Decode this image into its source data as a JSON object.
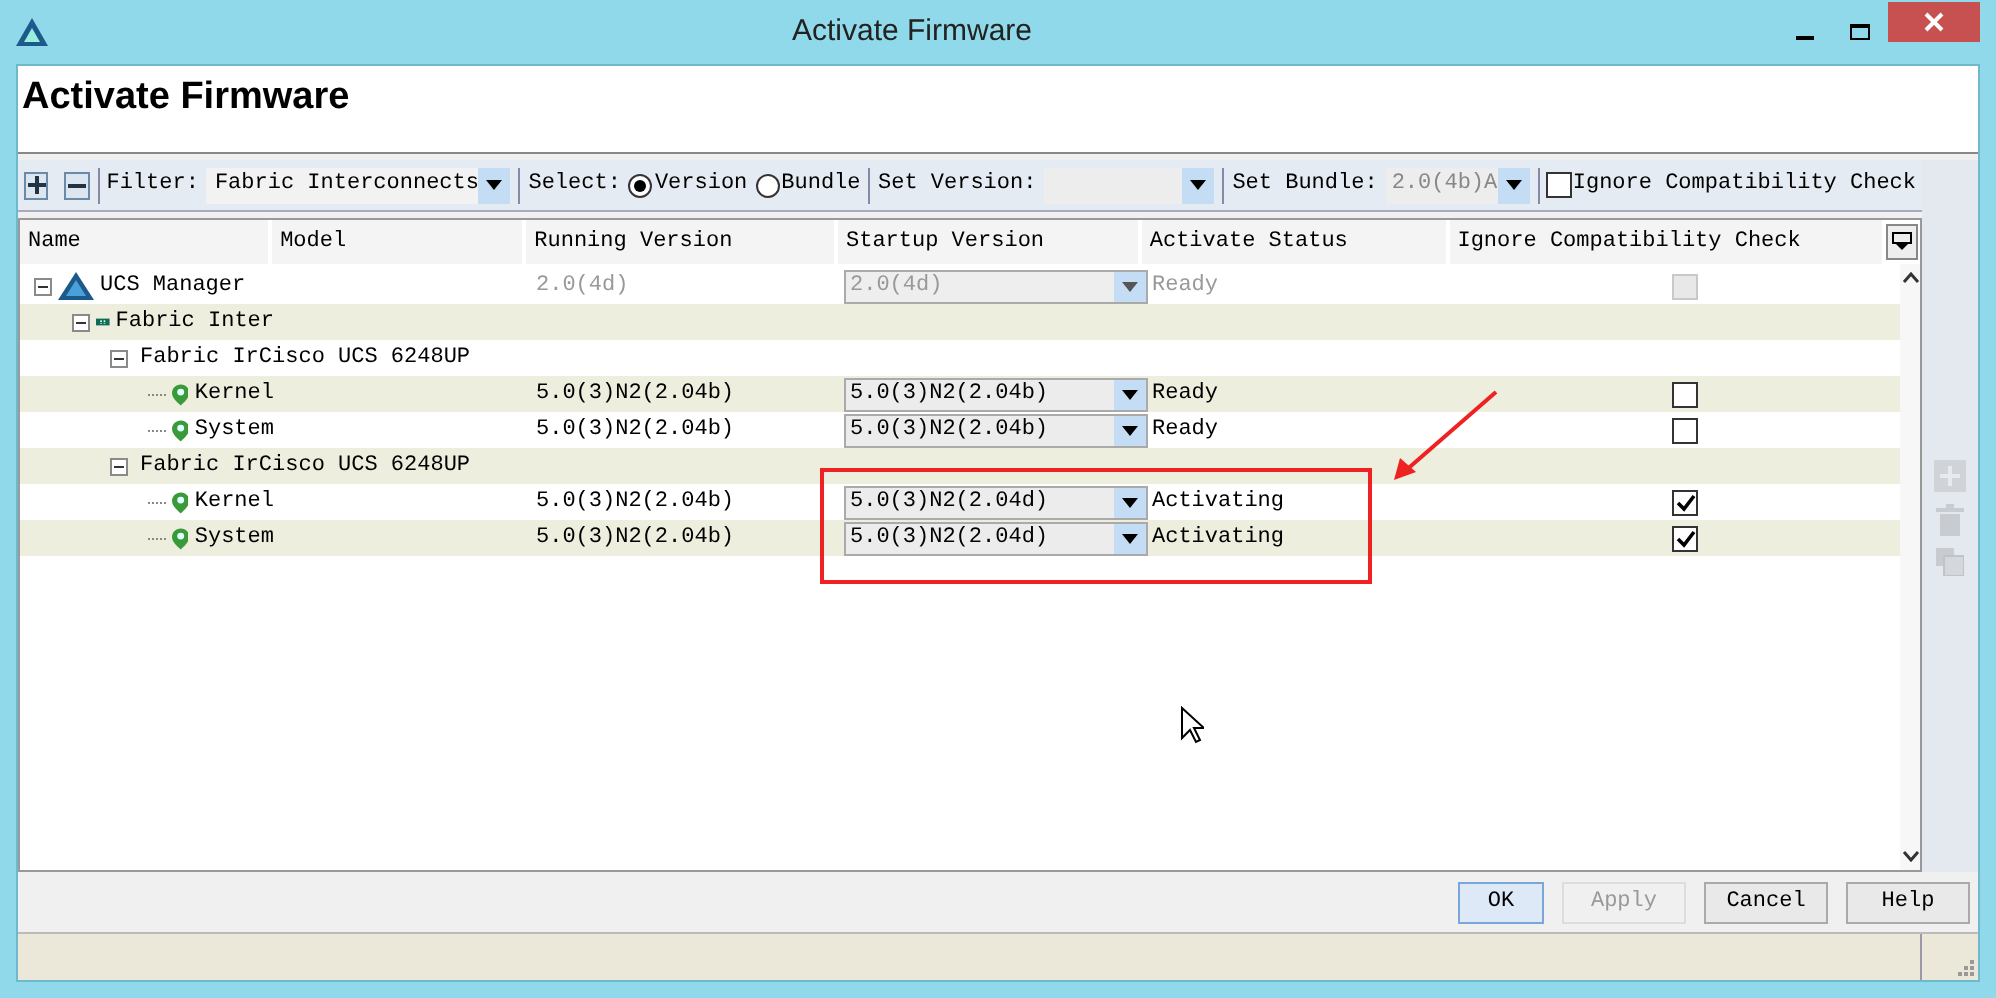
{
  "window": {
    "title": "Activate Firmware"
  },
  "header": {
    "title": "Activate Firmware"
  },
  "toolbar": {
    "filter_label": "Filter:",
    "filter_value": "Fabric Interconnects",
    "select_label": "Select:",
    "select_options": [
      {
        "label": "Version",
        "selected": true
      },
      {
        "label": "Bundle",
        "selected": false
      }
    ],
    "set_version_label": "Set Version:",
    "set_bundle_label": "Set Bundle:",
    "set_bundle_value": "2.0(4b)A",
    "ignore_check": {
      "label": "Ignore Compatibility Check",
      "checked": false
    }
  },
  "table": {
    "columns": [
      "Name",
      "Model",
      "Running Version",
      "Startup Version",
      "Activate Status",
      "Ignore Compatibility Check"
    ],
    "rows": [
      {
        "kind": "manager",
        "name": "UCS Manager",
        "expanded": true,
        "running_version": "2.0(4d)",
        "startup_version": "2.0(4d)",
        "status": "Ready",
        "ignore_check": false,
        "disabled": true,
        "children": [
          {
            "kind": "fabric",
            "name": "Fabric Inter",
            "expanded": true,
            "children": [
              {
                "kind": "fabric",
                "name": "Fabric IrCisco UCS 6248UP",
                "expanded": true,
                "children": [
                  {
                    "kind": "component",
                    "name": "Kernel",
                    "running_version": "5.0(3)N2(2.04b)",
                    "startup_version": "5.0(3)N2(2.04b)",
                    "status": "Ready",
                    "ignore_check": false,
                    "disabled": false
                  },
                  {
                    "kind": "component",
                    "name": "System",
                    "running_version": "5.0(3)N2(2.04b)",
                    "startup_version": "5.0(3)N2(2.04b)",
                    "status": "Ready",
                    "ignore_check": false,
                    "disabled": false
                  }
                ]
              },
              {
                "kind": "fabric",
                "name": "Fabric IrCisco UCS 6248UP",
                "expanded": true,
                "children": [
                  {
                    "kind": "component",
                    "name": "Kernel",
                    "running_version": "5.0(3)N2(2.04b)",
                    "startup_version": "5.0(3)N2(2.04d)",
                    "status": "Activating",
                    "ignore_check": true,
                    "disabled": false
                  },
                  {
                    "kind": "component",
                    "name": "System",
                    "running_version": "5.0(3)N2(2.04b)",
                    "startup_version": "5.0(3)N2(2.04d)",
                    "status": "Activating",
                    "ignore_check": true,
                    "disabled": false
                  }
                ]
              }
            ]
          }
        ]
      }
    ]
  },
  "buttons": [
    {
      "label": "OK",
      "disabled": false,
      "default": true
    },
    {
      "label": "Apply",
      "disabled": true,
      "default": false
    },
    {
      "label": "Cancel",
      "disabled": false,
      "default": false
    },
    {
      "label": "Help",
      "disabled": false,
      "default": false
    }
  ]
}
